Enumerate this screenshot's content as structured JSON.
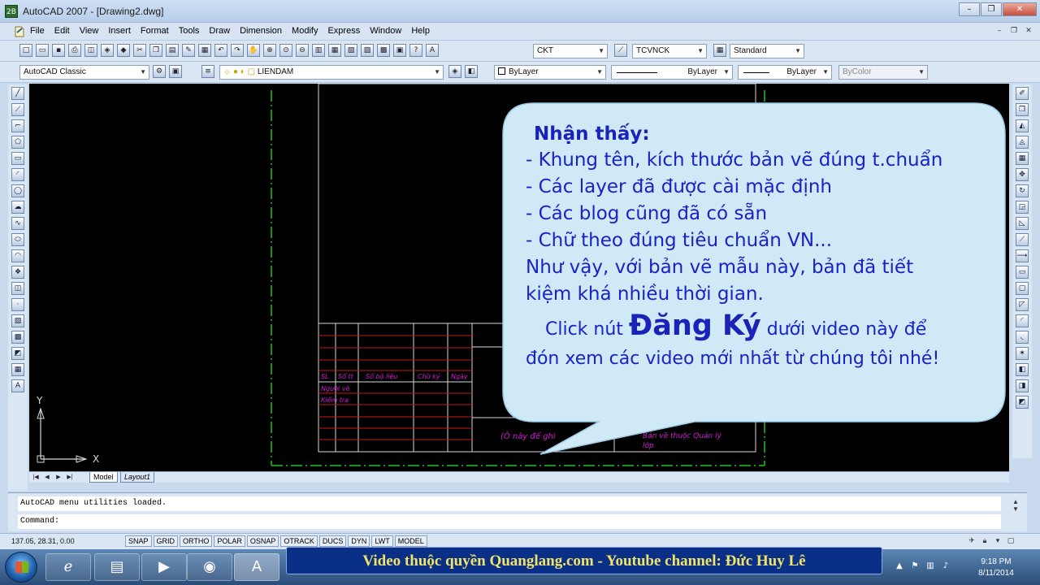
{
  "window": {
    "title": "AutoCAD 2007 - [Drawing2.dwg]",
    "app_icon_label": "2B",
    "controls": [
      "–",
      "❐",
      "✕"
    ]
  },
  "menu": {
    "items": [
      "File",
      "Edit",
      "View",
      "Insert",
      "Format",
      "Tools",
      "Draw",
      "Dimension",
      "Modify",
      "Express",
      "Window",
      "Help"
    ],
    "doc_controls": [
      "–",
      "❐",
      "✕"
    ]
  },
  "toolbar1": {
    "text_style": "CKT",
    "dim_style": "TCVNCK",
    "table_style": "Standard"
  },
  "toolbar2": {
    "workspace": "AutoCAD Classic",
    "layer": "LIENDAM",
    "color": "ByLayer",
    "linetype": "ByLayer",
    "lineweight": "ByLayer",
    "plot_style": "ByColor"
  },
  "layout_tabs": {
    "nav": [
      "|◀",
      "◀",
      "▶",
      "▶|"
    ],
    "tabs": [
      "Model",
      "Layout1"
    ]
  },
  "command": {
    "history": "AutoCAD menu utilities loaded.",
    "prompt": "Command:"
  },
  "statusbar": {
    "coordinates": "137.05, 28.31, 0.00",
    "toggles": [
      "SNAP",
      "GRID",
      "ORTHO",
      "POLAR",
      "OSNAP",
      "OTRACK",
      "DUCS",
      "DYN",
      "LWT",
      "MODEL"
    ]
  },
  "ucs": {
    "x_label": "X",
    "y_label": "Y"
  },
  "callout": {
    "heading": "Nhận thấy:",
    "lines": [
      "- Khung tên, kích thước bản vẽ đúng t.chuẩn",
      "- Các layer đã được cài mặc định",
      "- Các blog cũng đã có sẵn",
      "- Chữ theo đúng tiêu chuẩn VN...",
      "Như vậy, với bản vẽ mẫu này, bản đã tiết",
      "kiệm khá nhiều thời gian."
    ],
    "cta_before": "Click nút ",
    "cta_big": "Đăng Ký",
    "cta_after": " dưới video này để",
    "cta_line2": "đón xem các video mới nhất từ chúng tôi nhé!"
  },
  "title_block": {
    "cells": [
      "SL",
      "Số tt",
      "Số bộ liệu",
      "Chữ ký",
      "Ngày",
      "Người vẽ",
      "Kiểm tra",
      "(Ô này để ghi",
      "Bản vẽ thuộc Quản lý",
      "lớp"
    ]
  },
  "watermark": "Video thuộc quyền Quanglang.com - Youtube channel: Đức Huy Lê",
  "taskbar": {
    "clock_time": "9:18 PM",
    "clock_date": "8/11/2014"
  },
  "colors": {
    "canvas": "#000000",
    "callout_fill": "#cfe9f7",
    "callout_text": "#1a22c7",
    "watermark_bg": "#0a2f86",
    "watermark_text": "#f1e46a",
    "frame_green": "#19c21e",
    "table_red": "#c21a1a",
    "table_magenta": "#d21ad2"
  }
}
